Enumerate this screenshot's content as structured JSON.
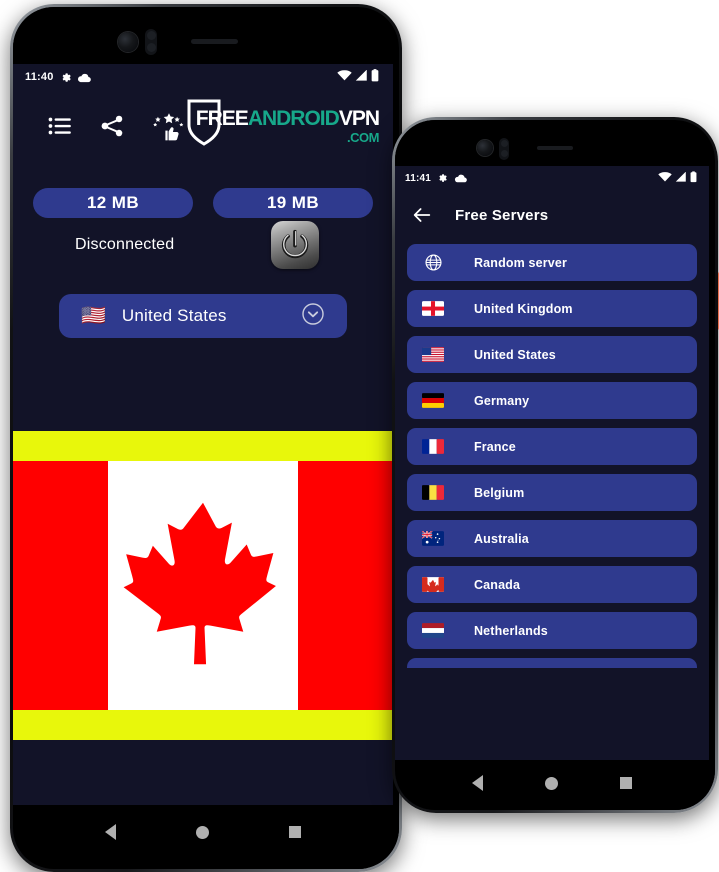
{
  "page": {
    "background": "#ffffff",
    "app_bg": "#121328",
    "card_blue": "#2f3a8e",
    "accent_teal": "#17a88a",
    "ad_yellow": "#e8f70b"
  },
  "phone1": {
    "statusbar": {
      "time": "11:40",
      "icons_left": [
        "gear-icon",
        "cloud-icon"
      ],
      "icons_right": [
        "wifi-icon",
        "signal-icon",
        "battery-icon"
      ]
    },
    "toolbar": {
      "icons": [
        {
          "name": "menu-list-icon",
          "label": "Menu"
        },
        {
          "name": "share-icon",
          "label": "Share"
        },
        {
          "name": "rate-us-icon",
          "label": "Rate us"
        }
      ],
      "logo": {
        "part1": "FREE",
        "part2": "ANDROID",
        "part3": "VPN",
        "part4": ".COM",
        "shield": "shield-icon"
      }
    },
    "stats": {
      "download_label": "12 MB",
      "upload_label": "19 MB"
    },
    "connection": {
      "status_text": "Disconnected",
      "power_button": "power-icon"
    },
    "country_selector": {
      "flag": "🇺🇸",
      "name": "United States",
      "chevron": "chevron-down-icon"
    },
    "ad": {
      "type": "canada-flag-banner",
      "top_bar_color": "#e8f70b",
      "bottom_bar_color": "#e8f70b",
      "flag_red": "#ff0000",
      "flag_white": "#ffffff"
    },
    "navbar": {
      "back": "nav-back-icon",
      "home": "nav-home-icon",
      "recents": "nav-recents-icon"
    }
  },
  "phone2": {
    "statusbar": {
      "time": "11:41",
      "icons_left": [
        "gear-icon",
        "cloud-icon"
      ],
      "icons_right": [
        "wifi-icon",
        "signal-icon",
        "battery-icon"
      ]
    },
    "appbar": {
      "back": "back-arrow-icon",
      "title": "Free Servers"
    },
    "servers": [
      {
        "flag": "globe-icon",
        "name": "Random server"
      },
      {
        "flag": "🏴󠁧󠁢󠁥󠁮󠁧󠁿",
        "name": "United Kingdom"
      },
      {
        "flag": "🇺🇸",
        "name": "United States"
      },
      {
        "flag": "🇩🇪",
        "name": "Germany"
      },
      {
        "flag": "🇫🇷",
        "name": "France"
      },
      {
        "flag": "🇧🇪",
        "name": "Belgium"
      },
      {
        "flag": "🇦🇺",
        "name": "Australia"
      },
      {
        "flag": "🇨🇦",
        "name": "Canada"
      },
      {
        "flag": "🇳🇱",
        "name": "Netherlands"
      }
    ],
    "navbar": {
      "back": "nav-back-icon",
      "home": "nav-home-icon",
      "recents": "nav-recents-icon"
    },
    "side_button": {
      "name": "power-side-button",
      "color": "#e8714d"
    }
  }
}
